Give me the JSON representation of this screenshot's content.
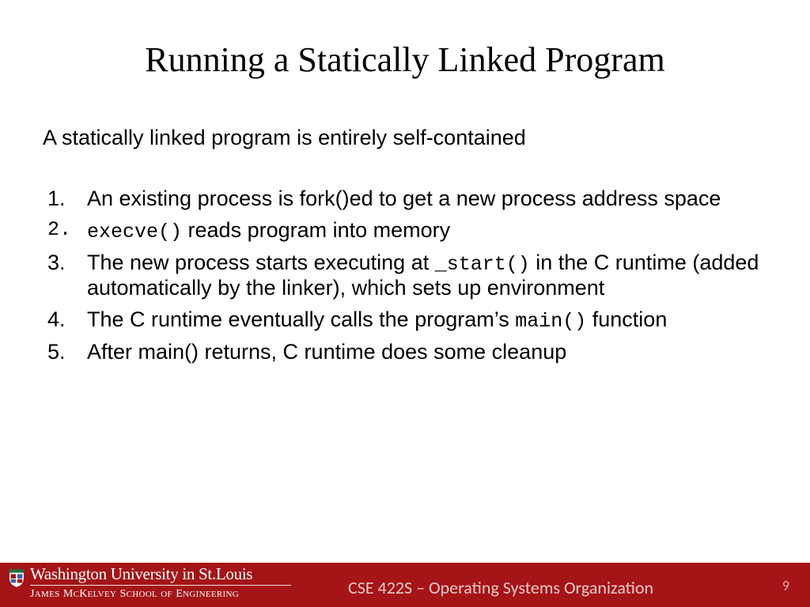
{
  "title": "Running a Statically Linked Program",
  "intro": "A statically linked program is entirely self-contained",
  "items": {
    "i1": "An existing process is fork()ed to get a new process address space",
    "i2_code": "execve()",
    "i2_rest": " reads program into memory",
    "i3_a": "The new process starts executing at ",
    "i3_code": "_start()",
    "i3_b": " in the C runtime (added automatically by the linker), which sets up environment",
    "i4_a": "The C runtime eventually calls the program’s ",
    "i4_code": "main()",
    "i4_b": " function",
    "i5": "After main() returns, C runtime does some cleanup"
  },
  "footer": {
    "university": "Washington University in St.Louis",
    "school_parts": {
      "p1": "J",
      "p2": "AMES",
      "sp1": " ",
      "p3": "M",
      "p4": "C",
      "p5": "K",
      "p6": "ELVEY",
      "sp2": " ",
      "p7": "S",
      "p8": "CHOOL",
      "sp3": " ",
      "p9": "OF",
      "sp4": " ",
      "p10": "E",
      "p11": "NGINEERING"
    },
    "course": "CSE 422S – Operating Systems Organization",
    "page": "9"
  }
}
